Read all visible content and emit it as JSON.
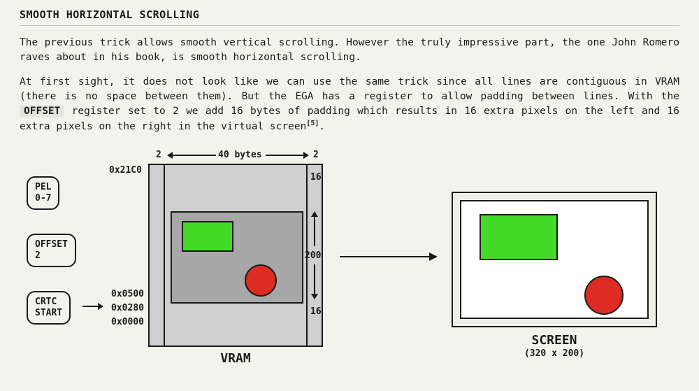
{
  "section_title": "SMOOTH HORIZONTAL SCROLLING",
  "para1": "The previous trick allows smooth vertical scrolling. However the truly impressive part, the one John Romero raves about in his book, is smooth horizontal scrolling.",
  "para2a": "At first sight, it does not look like we can use the same trick since all lines are contiguous in VRAM (there is no space between them). But the EGA has a register to allow padding between lines. With the ",
  "offset_code": "OFFSET",
  "para2b": " register set to 2 we add 16 bytes of padding which results in 16 extra pixels on the left and 16 extra pixels on the right in the virtual screen",
  "footnote_ref": "[5]",
  "para2c": ".",
  "pill_pel": "PEL\n0-7",
  "pill_offset": "OFFSET\n2",
  "pill_crtc": "CRTC\nSTART",
  "addr_top": "0x21C0",
  "addrs": "0x0500\n0x0280\n0x0000",
  "pad_left": "2",
  "pad_right": "2",
  "bytes_label": "40 bytes",
  "pad_top": "16",
  "height_label": "200",
  "pad_bottom": "16",
  "vram_label": "VRAM",
  "screen_label": "SCREEN",
  "screen_res": "(320 x 200)"
}
